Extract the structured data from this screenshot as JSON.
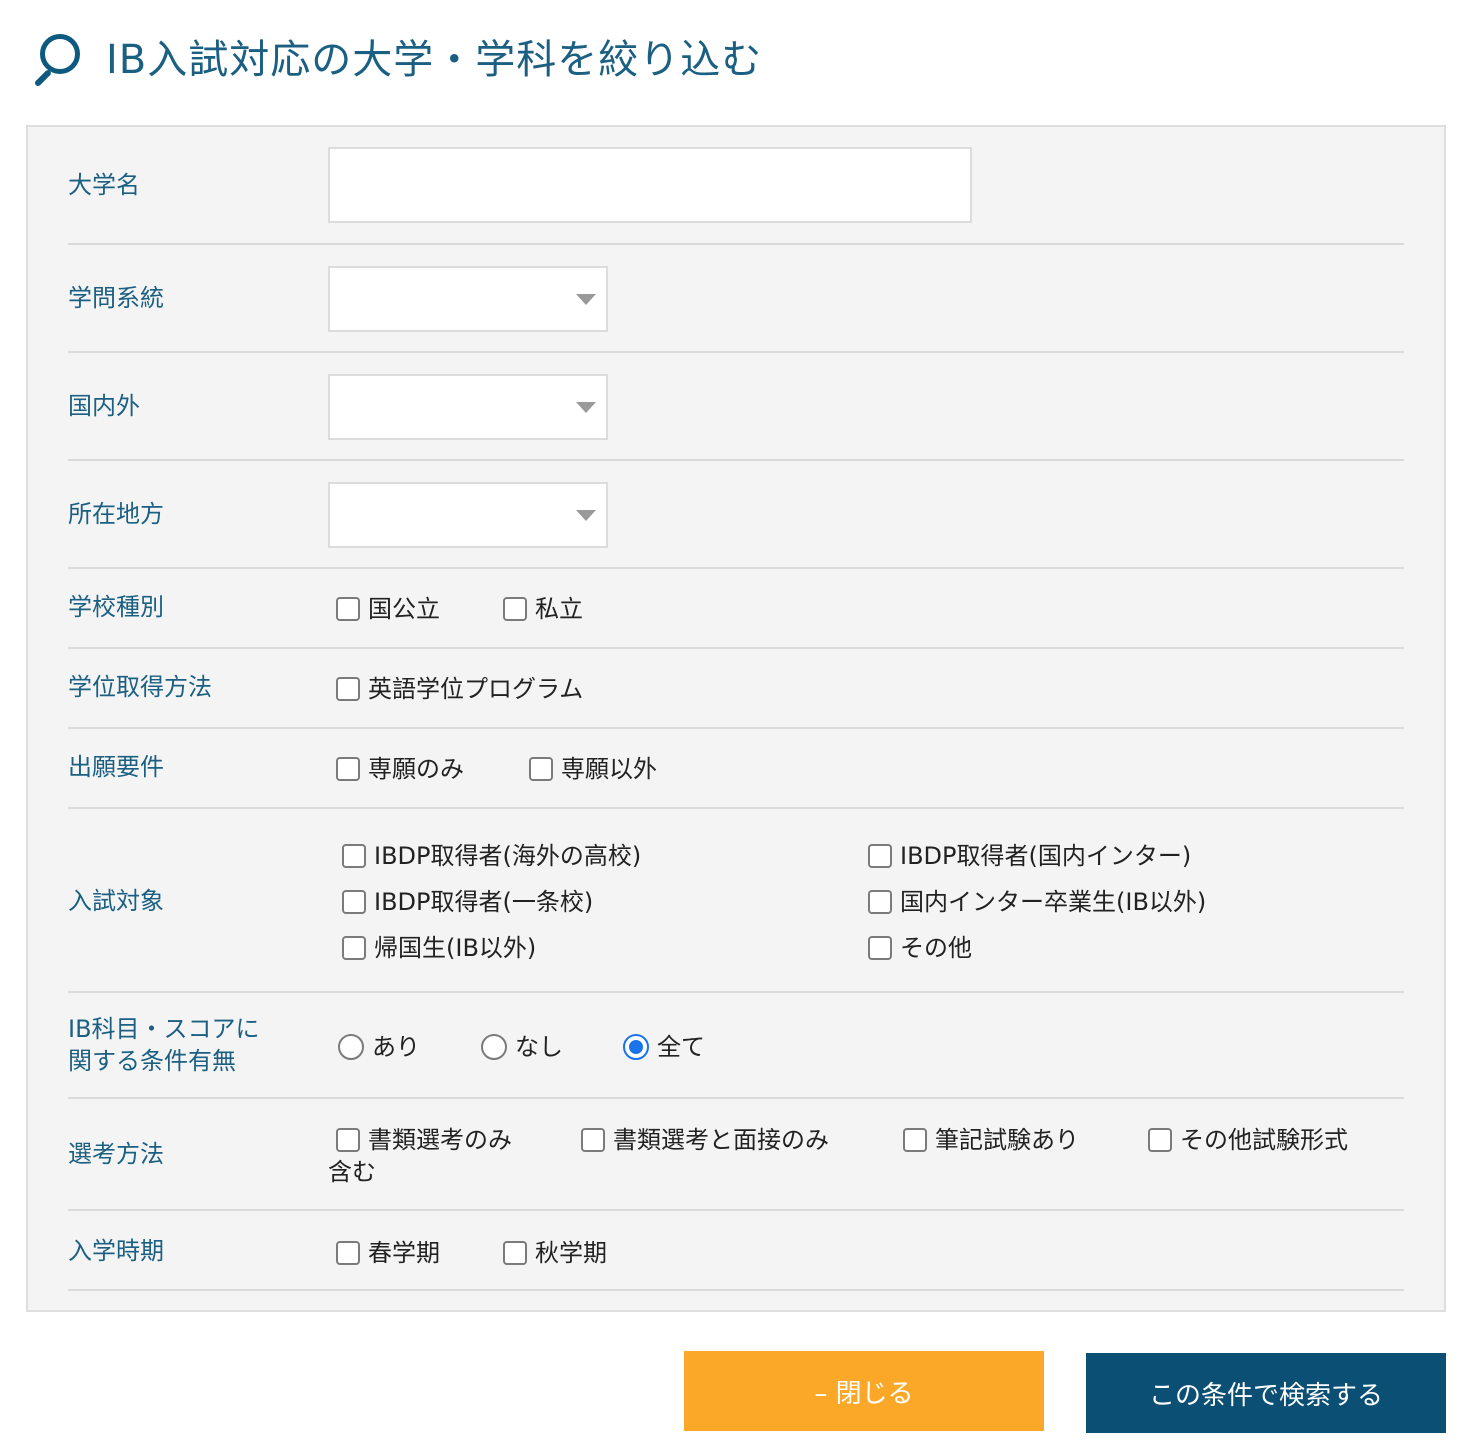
{
  "header": {
    "title": "IB入試対応の大学・学科を絞り込む",
    "icon": "search-icon"
  },
  "fields": {
    "university_name": {
      "label": "大学名",
      "value": "",
      "placeholder": ""
    },
    "academic_field": {
      "label": "学問系統",
      "value": ""
    },
    "domestic_overseas": {
      "label": "国内外",
      "value": ""
    },
    "region": {
      "label": "所在地方",
      "value": ""
    },
    "school_type": {
      "label": "学校種別",
      "options": [
        "国公立",
        "私立"
      ]
    },
    "degree_method": {
      "label": "学位取得方法",
      "options": [
        "英語学位プログラム"
      ]
    },
    "application_req": {
      "label": "出願要件",
      "options": [
        "専願のみ",
        "専願以外"
      ]
    },
    "exam_target": {
      "label": "入試対象",
      "options": [
        "IBDP取得者(海外の高校)",
        "IBDP取得者(国内インター)",
        "IBDP取得者(一条校)",
        "国内インター卒業生(IB以外)",
        "帰国生(IB以外)",
        "その他"
      ]
    },
    "ib_condition": {
      "label_line1": "IB科目・スコアに",
      "label_line2": "関する条件有無",
      "options": [
        "あり",
        "なし",
        "全て"
      ],
      "selected": "全て"
    },
    "selection_method": {
      "label": "選考方法",
      "options": [
        "書類選考のみ",
        "書類選考と面接のみ",
        "筆記試験あり",
        "その他試験形式"
      ],
      "wrap_text": "含む"
    },
    "enrollment_period": {
      "label": "入学時期",
      "options": [
        "春学期",
        "秋学期"
      ]
    }
  },
  "buttons": {
    "close": "– 閉じる",
    "search": "この条件で検索する"
  },
  "colors": {
    "accent": "#1b5f82",
    "close_button": "#fba828",
    "search_button": "#0b4f74",
    "panel_bg": "#f4f4f4"
  }
}
